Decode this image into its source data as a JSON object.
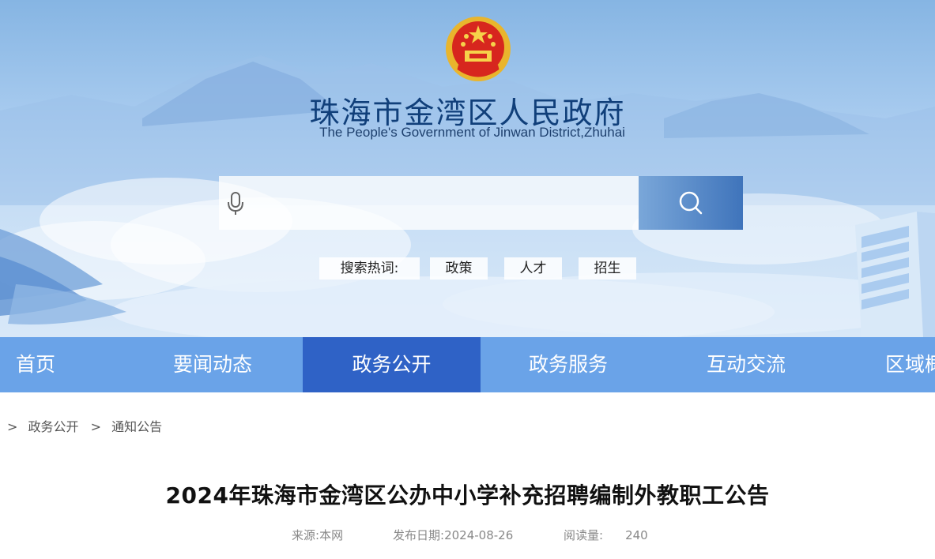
{
  "header": {
    "site_name": "珠海市金湾区人民政府",
    "site_name_en": "The People's Government of Jinwan District,Zhuhai"
  },
  "search": {
    "placeholder": "",
    "hot_label": "搜索热词:",
    "hot_words": [
      "政策",
      "人才",
      "招生"
    ]
  },
  "nav": {
    "items": [
      "首页",
      "要闻动态",
      "政务公开",
      "政务服务",
      "互动交流",
      "区域概况"
    ],
    "active": "政务公开"
  },
  "breadcrumb": {
    "sep": ">",
    "items": [
      "政务公开",
      "通知公告"
    ]
  },
  "article": {
    "title": "2024年珠海市金湾区公办中小学补充招聘编制外教职工公告",
    "source_label": "来源:",
    "source": "本网",
    "date_label": "发布日期:",
    "date": "2024-08-26",
    "reads_label": "阅读量:",
    "reads": "240"
  },
  "colors": {
    "nav_bg": "#6aa3e8",
    "nav_active": "#2f62c6",
    "search_button": "#4f82c4",
    "title_text": "#103f7a"
  },
  "icons": {
    "emblem": "national-emblem-icon",
    "mic": "microphone-icon",
    "search": "search-icon"
  }
}
